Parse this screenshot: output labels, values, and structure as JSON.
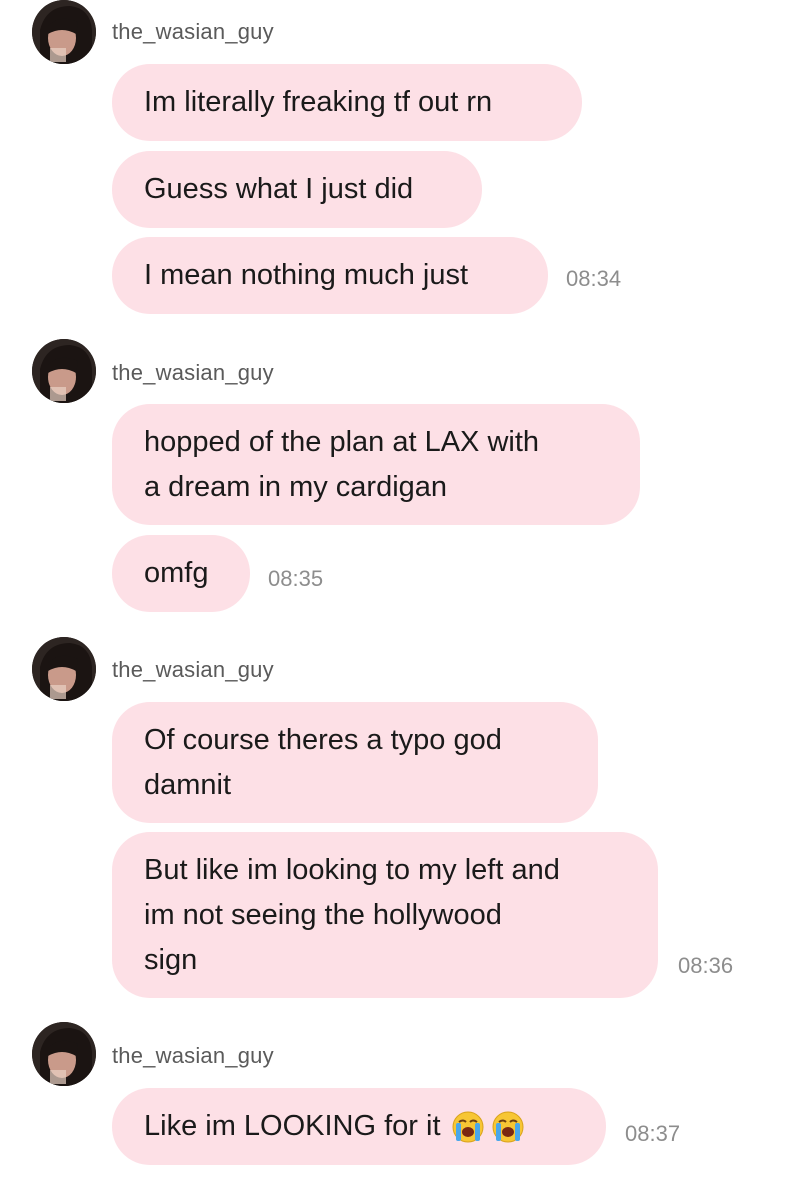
{
  "username": "the_wasian_guy",
  "colors": {
    "bubble": "#fde0e6",
    "time": "#8d8d8d",
    "username": "#5a5a5a"
  },
  "groups": [
    {
      "messages": [
        "Im literally freaking tf out rn",
        "Guess what I just did",
        "I mean nothing much just"
      ],
      "time": "08:34"
    },
    {
      "messages": [
        "hopped of the plan at LAX with\na dream in my cardigan",
        "omfg"
      ],
      "time": "08:35"
    },
    {
      "messages": [
        "Of course theres a typo god\ndamnit",
        "But like im looking to my left and\nim not seeing the hollywood\nsign"
      ],
      "time": "08:36"
    },
    {
      "messages": [
        "Like im LOOKING for it"
      ],
      "emojis": [
        "loudly-crying-face-icon",
        "loudly-crying-face-icon"
      ],
      "time": "08:37"
    }
  ]
}
